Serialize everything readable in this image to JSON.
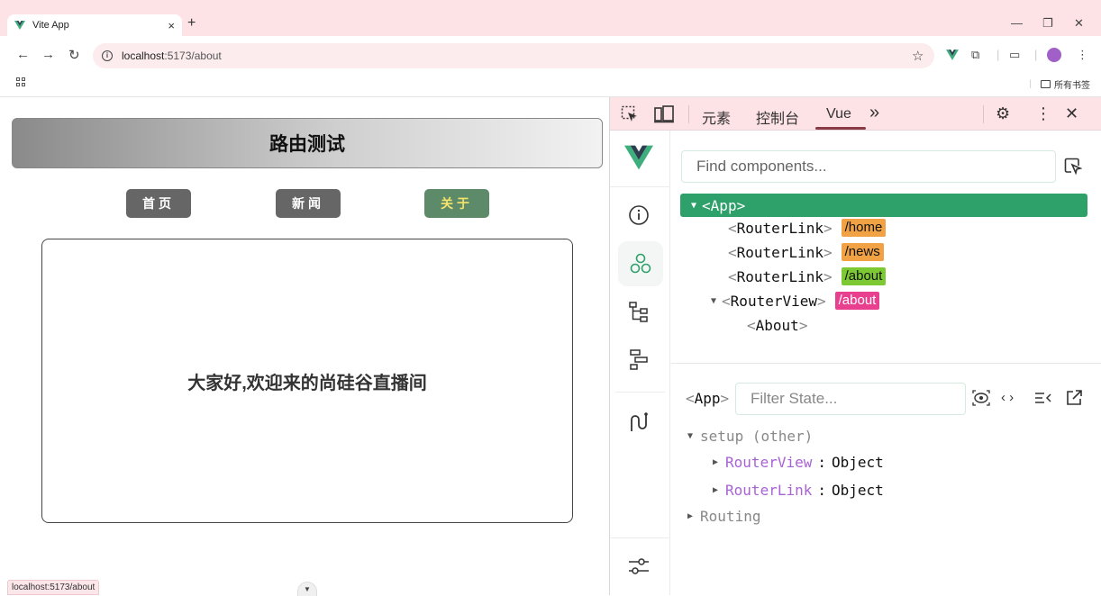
{
  "browser": {
    "tab_title": "Vite App",
    "tab_close": "×",
    "new_tab": "+",
    "url_host": "localhost",
    "url_path": ":5173/about",
    "all_bookmarks": "所有书签",
    "status_url": "localhost:5173/about"
  },
  "page": {
    "banner_title": "路由测试",
    "nav": [
      {
        "label": "首页",
        "active": false
      },
      {
        "label": "新闻",
        "active": false
      },
      {
        "label": "关于",
        "active": true
      }
    ],
    "content_message": "大家好,欢迎来的尚硅谷直播间"
  },
  "devtools": {
    "tabs": [
      "元素",
      "控制台",
      "Vue"
    ],
    "active_tab": "Vue",
    "more": "»",
    "components": {
      "search_placeholder": "Find components...",
      "tree": [
        {
          "name": "App",
          "tag": null,
          "selected": true,
          "expanded": true
        },
        {
          "name": "RouterLink",
          "tag": "/home",
          "tag_color": "#f0a244"
        },
        {
          "name": "RouterLink",
          "tag": "/news",
          "tag_color": "#f0a244"
        },
        {
          "name": "RouterLink",
          "tag": "/about",
          "tag_color": "#7cc934"
        },
        {
          "name": "RouterView",
          "tag": "/about",
          "tag_color": "#e8408f",
          "expanded": true
        },
        {
          "name": "About",
          "tag": null
        }
      ]
    },
    "state": {
      "selected": "App",
      "filter_placeholder": "Filter State...",
      "section": "setup (other)",
      "items": [
        {
          "key": "RouterView",
          "value": "Object"
        },
        {
          "key": "RouterLink",
          "value": "Object"
        }
      ],
      "routing": "Routing"
    }
  },
  "colors": {
    "accent": "#2ea06a",
    "chrome_bg": "#fde2e6",
    "active_nav": "#5d8a68"
  }
}
